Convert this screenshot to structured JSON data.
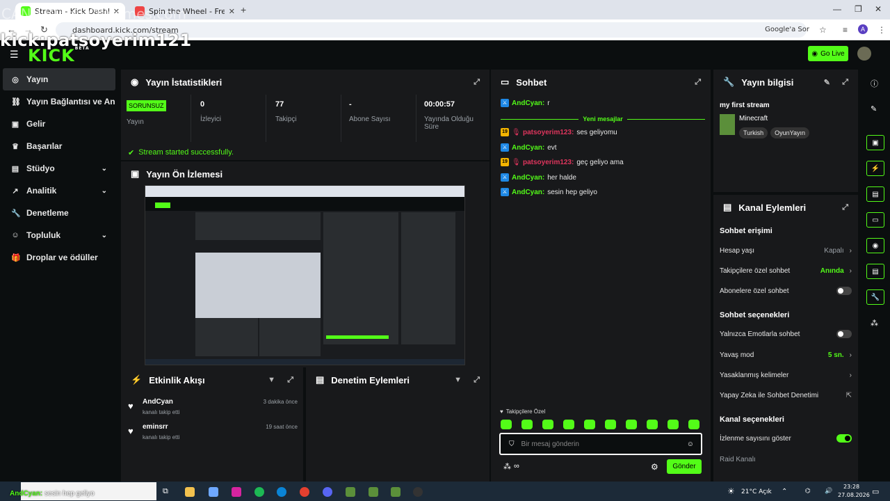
{
  "browser": {
    "active_tab": "Stream - Kick Dashboard",
    "inactive_tab": "Spin the Wheel - Free Wheel Spinner",
    "url": "dashboard.kick.com/stream",
    "google_btn": "Google'a Sor",
    "overlay_top": "CAN / WheelOfNames.com",
    "profile_initial": "A"
  },
  "overlay": {
    "handle": "kick:patsoyerim121"
  },
  "app": {
    "logo": "KICK",
    "logo_beta": "BETA",
    "go_live": "Go Live"
  },
  "nav": {
    "items": [
      {
        "label": "Yayın",
        "icon": "stream-icon"
      },
      {
        "label": "Yayın Bağlantısı ve Anahtarı",
        "icon": "link-icon"
      },
      {
        "label": "Gelir",
        "icon": "revenue-icon"
      },
      {
        "label": "Başarılar",
        "icon": "trophy-icon"
      },
      {
        "label": "Stüdyo",
        "icon": "studio-icon"
      },
      {
        "label": "Analitik",
        "icon": "analytics-icon"
      },
      {
        "label": "Denetleme",
        "icon": "wrench-icon"
      },
      {
        "label": "Topluluk",
        "icon": "community-icon"
      },
      {
        "label": "Droplar ve ödüller",
        "icon": "gift-icon"
      }
    ]
  },
  "stats": {
    "title": "Yayın İstatistikleri",
    "status_badge": "SORUNSUZ",
    "status_label": "Yayın",
    "viewers_value": "0",
    "viewers_label": "İzleyici",
    "followers_value": "77",
    "followers_label": "Takipçi",
    "subs_value": "-",
    "subs_label": "Abone Sayısı",
    "uptime_value": "00:00:57",
    "uptime_label": "Yayında Olduğu Süre",
    "success": "Stream started successfully."
  },
  "preview": {
    "title": "Yayın Ön İzlemesi"
  },
  "activity": {
    "title": "Etkinlik Akışı",
    "items": [
      {
        "name": "AndCyan",
        "sub": "kanalı takip etti",
        "time": "3 dakika önce"
      },
      {
        "name": "eminsrr",
        "sub": "kanalı takip etti",
        "time": "19 saat önce"
      }
    ]
  },
  "moderation": {
    "title": "Denetim Eylemleri"
  },
  "chat": {
    "title": "Sohbet",
    "first_msg": {
      "name": "AndCyan:",
      "text": "r"
    },
    "new_messages": "Yeni mesajlar",
    "messages": [
      {
        "name": "patsoyerim123:",
        "text": "ses geliyomu",
        "kind": "owner"
      },
      {
        "name": "AndCyan:",
        "text": "evt",
        "kind": "mod"
      },
      {
        "name": "patsoyerim123:",
        "text": "geç geliyo ama",
        "kind": "owner"
      },
      {
        "name": "AndCyan:",
        "text": "her halde",
        "kind": "mod"
      },
      {
        "name": "AndCyan:",
        "text": "sesin hep geliyo",
        "kind": "mod"
      }
    ],
    "followers_only": "Takipçilere Özel",
    "placeholder": "Bir mesaj gönderin",
    "send": "Gönder",
    "loop": "∞"
  },
  "stream_info": {
    "title": "Yayın bilgisi",
    "stream_title": "my first stream",
    "category": "Minecraft",
    "tags": [
      "Turkish",
      "OyunYayın"
    ]
  },
  "channel_actions": {
    "title": "Kanal Eylemleri",
    "chat_access": "Sohbet erişimi",
    "account_age": "Hesap yaşı",
    "account_age_val": "Kapalı",
    "followers_chat": "Takipçilere özel sohbet",
    "followers_chat_val": "Anında",
    "subs_chat": "Abonelere özel sohbet",
    "chat_options": "Sohbet seçenekleri",
    "emote_only": "Yalnızca Emotlarla sohbet",
    "slow_mode": "Yavaş mod",
    "slow_mode_val": "5 sn.",
    "banned_words": "Yasaklanmış kelimeler",
    "ai_moderation": "Yapay Zeka ile Sohbet Denetimi",
    "channel_options": "Kanal seçenekleri",
    "show_viewers": "İzlenme sayısını göster",
    "raid": "Raid Kanalı"
  },
  "taskbar": {
    "toast_name": "AndCyan:",
    "toast_msg": "sesin hep geliyo",
    "weather": "21°C Açık",
    "time": "23:28",
    "date": "27.08.2026"
  },
  "colors": {
    "accent": "#53fc18",
    "panel": "#18191b",
    "bg": "#0b0e0f"
  }
}
